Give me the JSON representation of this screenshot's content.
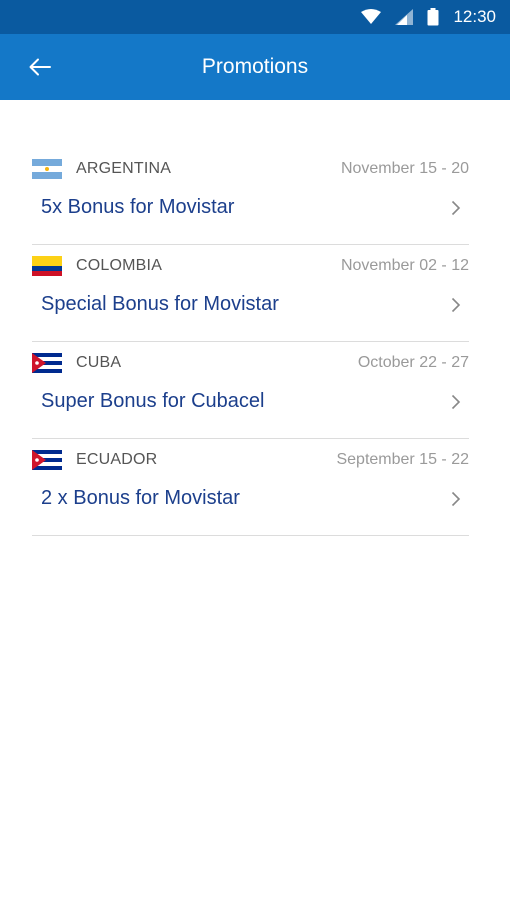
{
  "status_bar": {
    "time": "12:30",
    "icons": [
      "wifi-icon",
      "signal-icon",
      "battery-icon"
    ]
  },
  "app_bar": {
    "title": "Promotions",
    "back_icon": "arrow-left-icon",
    "color": "#1478c8"
  },
  "promotions": [
    {
      "country": "ARGENTINA",
      "flag": "argentina-flag",
      "dates": "November 15 - 20",
      "title": "5x Bonus for Movistar"
    },
    {
      "country": "COLOMBIA",
      "flag": "colombia-flag",
      "dates": "November 02 - 12",
      "title": "Special Bonus for Movistar"
    },
    {
      "country": "CUBA",
      "flag": "cuba-flag",
      "dates": "October 22 - 27",
      "title": "Super Bonus for Cubacel"
    },
    {
      "country": "ECUADOR",
      "flag": "cuba-flag",
      "dates": "September 15 - 22",
      "title": "2 x Bonus for Movistar"
    }
  ],
  "colors": {
    "status_bar": "#0a5aa0",
    "title_text": "#1c3f8c",
    "date_text": "#9a9a9a",
    "divider": "#dcdcdc"
  }
}
